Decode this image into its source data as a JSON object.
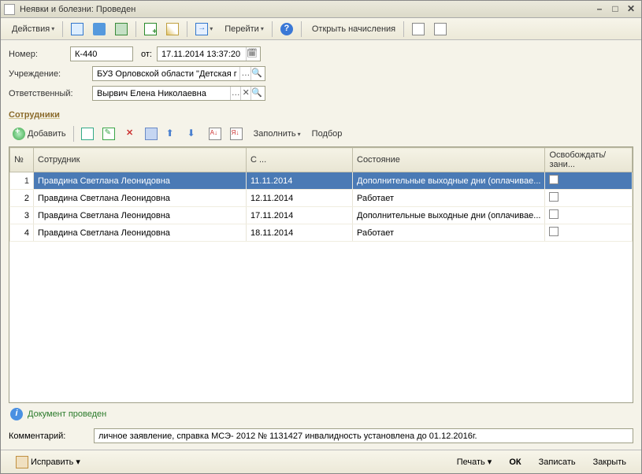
{
  "window": {
    "title": "Неявки и болезни: Проведен"
  },
  "toolbar": {
    "actions": "Действия",
    "goto": "Перейти",
    "open_calc": "Открыть начисления"
  },
  "form": {
    "number_label": "Номер:",
    "number": "К-440",
    "from_label": "от:",
    "date": "17.11.2014 13:37:20",
    "org_label": "Учреждение:",
    "org": "БУЗ Орловской области \"Детская г ...",
    "resp_label": "Ответственный:",
    "resp": "Вырвич Елена Николаевна"
  },
  "section": {
    "title": "Сотрудники"
  },
  "tabletoolbar": {
    "add": "Добавить",
    "fill": "Заполнить",
    "pick": "Подбор"
  },
  "columns": {
    "num": "№",
    "emp": "Сотрудник",
    "from": "С ...",
    "state": "Состояние",
    "free": "Освобождать/зани..."
  },
  "rows": [
    {
      "n": "1",
      "emp": "Правдина Светлана Леонидовна",
      "from": "11.11.2014",
      "state": "Дополнительные выходные дни (оплачивае...",
      "sel": true
    },
    {
      "n": "2",
      "emp": "Правдина Светлана Леонидовна",
      "from": "12.11.2014",
      "state": "Работает"
    },
    {
      "n": "3",
      "emp": "Правдина Светлана Леонидовна",
      "from": "17.11.2014",
      "state": "Дополнительные выходные дни (оплачивае..."
    },
    {
      "n": "4",
      "emp": "Правдина Светлана Леонидовна",
      "from": "18.11.2014",
      "state": "Работает"
    }
  ],
  "status": {
    "text": "Документ проведен"
  },
  "comment": {
    "label": "Комментарий:",
    "value": "личное заявление, справка МСЭ- 2012 № 1131427 инвалидность установлена до 01.12.2016г."
  },
  "footer": {
    "fix": "Исправить",
    "print": "Печать",
    "ok": "ОК",
    "save": "Записать",
    "close": "Закрыть"
  }
}
